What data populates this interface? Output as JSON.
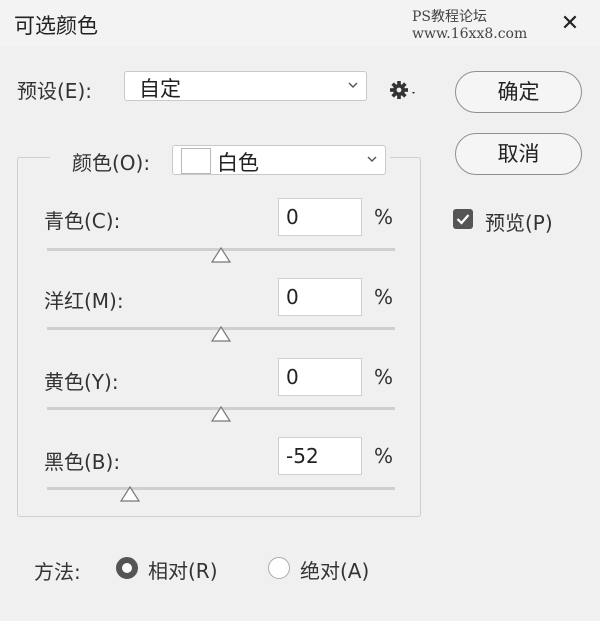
{
  "window": {
    "title": "可选颜色",
    "watermark": "PS教程论坛 www.16xx8.com",
    "close_glyph": "✕"
  },
  "preset": {
    "label": "预设(E):",
    "value": "自定"
  },
  "buttons": {
    "ok": "确定",
    "cancel": "取消"
  },
  "preview": {
    "label": "预览(P)",
    "checked": true
  },
  "colors": {
    "label": "颜色(O):",
    "value": "白色",
    "swatch_color": "#ffffff"
  },
  "sliders": [
    {
      "label": "青色(C):",
      "value": "0",
      "unit": "%"
    },
    {
      "label": "洋红(M):",
      "value": "0",
      "unit": "%"
    },
    {
      "label": "黄色(Y):",
      "value": "0",
      "unit": "%"
    },
    {
      "label": "黑色(B):",
      "value": "-52",
      "unit": "%"
    }
  ],
  "method": {
    "label": "方法:",
    "relative": "相对(R)",
    "absolute": "绝对(A)",
    "selected": "relative"
  }
}
